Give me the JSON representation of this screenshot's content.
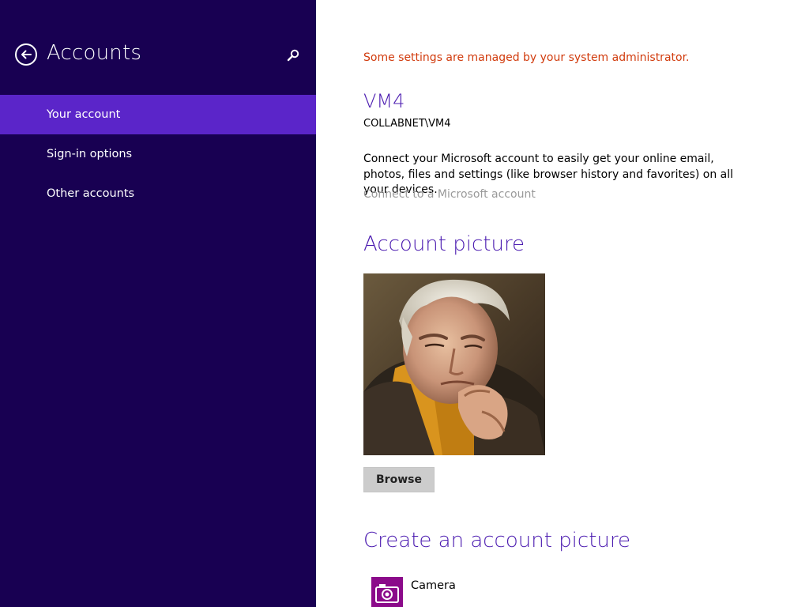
{
  "left_pane": {
    "title": "Accounts",
    "back_icon": "back-arrow-circle-icon",
    "search_icon": "search-icon",
    "items": [
      {
        "label": "Your account",
        "selected": true
      },
      {
        "label": "Sign-in options",
        "selected": false
      },
      {
        "label": "Other accounts",
        "selected": false
      }
    ]
  },
  "main": {
    "admin_note": "Some settings are managed by your system administrator.",
    "user_name": "VM4",
    "domain_name": "COLLABNET\\VM4",
    "connect_text": "Connect your Microsoft account to easily get your online email, photos, files and settings (like browser history and favorites) on all your devices.",
    "connect_link": "Connect to a Microsoft account",
    "account_picture_heading": "Account picture",
    "browse_label": "Browse",
    "create_heading": "Create an account picture",
    "camera_label": "Camera",
    "camera_icon": "camera-icon"
  },
  "colors": {
    "left_pane_bg": "#180052",
    "selected_item_bg": "#5b25c9",
    "heading": "#4b1bb0",
    "admin_note": "#d13b0d",
    "camera_tile": "#8b0a8a"
  }
}
